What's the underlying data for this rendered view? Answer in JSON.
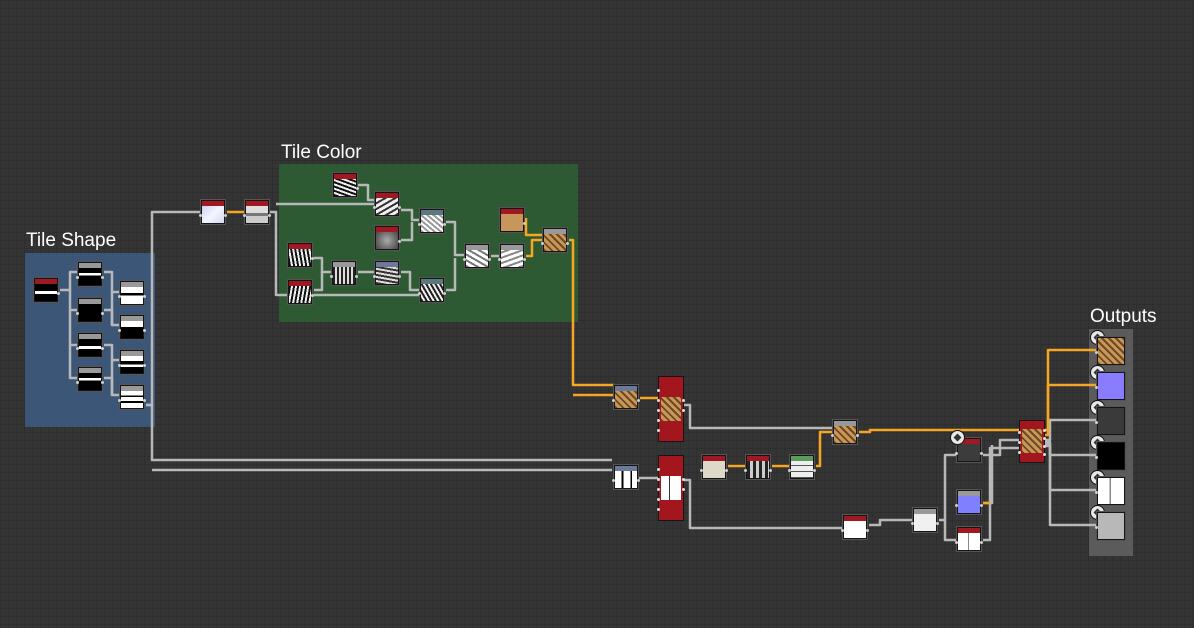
{
  "frames": {
    "tile_shape": {
      "label": "Tile Shape",
      "color": "#3d5a80"
    },
    "tile_color": {
      "label": "Tile Color",
      "color": "#2d5a33"
    },
    "outputs": {
      "label": "Outputs",
      "color": "#5a5a5a"
    }
  },
  "colors": {
    "canvas": "#343434",
    "wire_gray": "#b8b8b8",
    "wire_orange": "#f5a623",
    "node_header_red": "#a01822"
  },
  "icons": {
    "output_node": "output-cube-icon",
    "view_node": "view-icon"
  }
}
